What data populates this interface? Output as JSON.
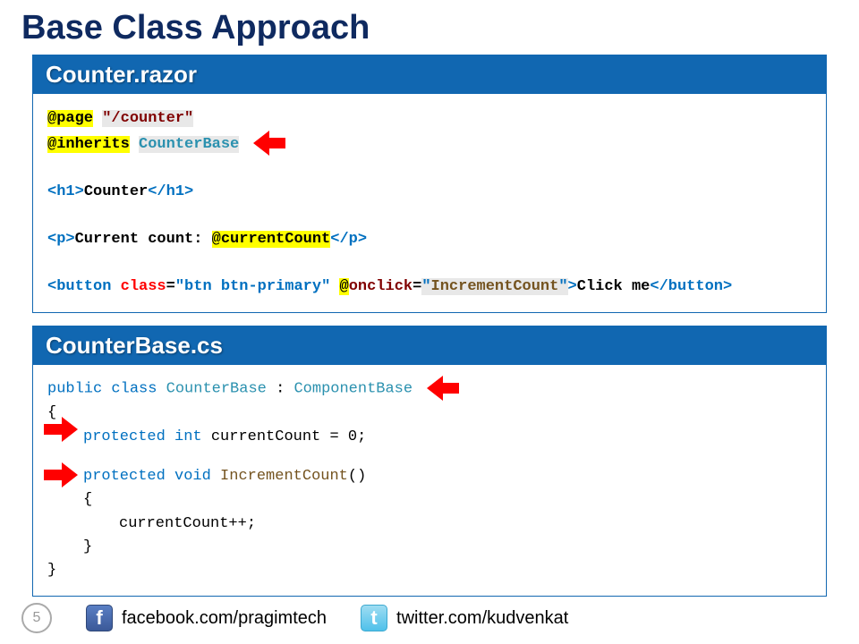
{
  "title": "Base Class Approach",
  "panel1": {
    "header": "Counter.razor",
    "code": {
      "page_dir": "@page",
      "page_route": "\"/counter\"",
      "inherits_dir": "@inherits",
      "inherits_val": "CounterBase",
      "h1_open": "<h1>",
      "h1_text": "Counter",
      "h1_close": "</h1>",
      "p_open": "<p>",
      "p_text": "Current count: ",
      "at_current": "@currentCount",
      "p_close": "</p>",
      "btn_open": "<button",
      "btn_class_attr": "class",
      "btn_class_val": "\"btn btn-primary\"",
      "btn_at_onclick": "@",
      "btn_onclick_attr": "onclick",
      "btn_onclick_val1": "\"",
      "btn_onclick_method": "IncrementCount",
      "btn_onclick_val2": "\"",
      "btn_open_end": ">",
      "btn_text": "Click me",
      "btn_close": "</button>"
    }
  },
  "panel2": {
    "header": "CounterBase.cs",
    "code": {
      "public": "public",
      "class": "class",
      "classname": "CounterBase",
      "colon": ":",
      "base": "ComponentBase",
      "open_brace": "{",
      "protected1": "protected",
      "int": "int",
      "field": "currentCount = 0;",
      "protected2": "protected",
      "void": "void",
      "method": "IncrementCount",
      "parens": "()",
      "open_brace2": "{",
      "body": "currentCount++;",
      "close_brace2": "}",
      "close_brace": "}"
    }
  },
  "footer": {
    "page_num": "5",
    "fb_glyph": "f",
    "fb_text": "facebook.com/pragimtech",
    "tw_glyph": "t",
    "tw_text": "twitter.com/kudvenkat"
  }
}
